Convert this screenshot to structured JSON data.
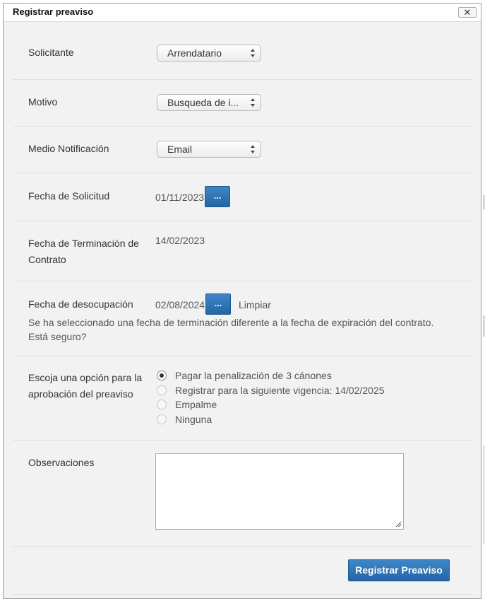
{
  "dialog": {
    "title": "Registrar preaviso",
    "close_label": "✕"
  },
  "form": {
    "solicitante": {
      "label": "Solicitante",
      "value": "Arrendatario"
    },
    "motivo": {
      "label": "Motivo",
      "value": "Busqueda de i..."
    },
    "medio": {
      "label": "Medio Notificación",
      "value": "Email"
    },
    "fecha_solicitud": {
      "label": "Fecha de Solicitud",
      "value": "01/11/2023",
      "button": "..."
    },
    "fecha_terminacion": {
      "label_line1": "Fecha de Terminación de",
      "label_line2": "Contrato",
      "value": "14/02/2023"
    },
    "fecha_desocupacion": {
      "label": "Fecha de desocupación",
      "value": "02/08/2024",
      "button": "...",
      "clear": "Limpiar",
      "warning": "Se ha seleccionado una fecha de terminación diferente a la fecha de expiración del contrato. Está seguro?"
    },
    "aprobacion": {
      "label_line1": "Escoja una opción para la",
      "label_line2": "aprobación del preaviso",
      "options": [
        {
          "label": "Pagar la penalización de 3 cánones",
          "checked": true
        },
        {
          "label": "Registrar para la siguiente vigencia: 14/02/2025",
          "checked": false
        },
        {
          "label": "Empalme",
          "checked": false
        },
        {
          "label": "Ninguna",
          "checked": false
        }
      ]
    },
    "observaciones": {
      "label": "Observaciones",
      "value": ""
    },
    "submit_label": "Registrar Preaviso"
  },
  "colors": {
    "primary_button": "#2d73b6",
    "dialog_bg": "#f2f2f2"
  }
}
